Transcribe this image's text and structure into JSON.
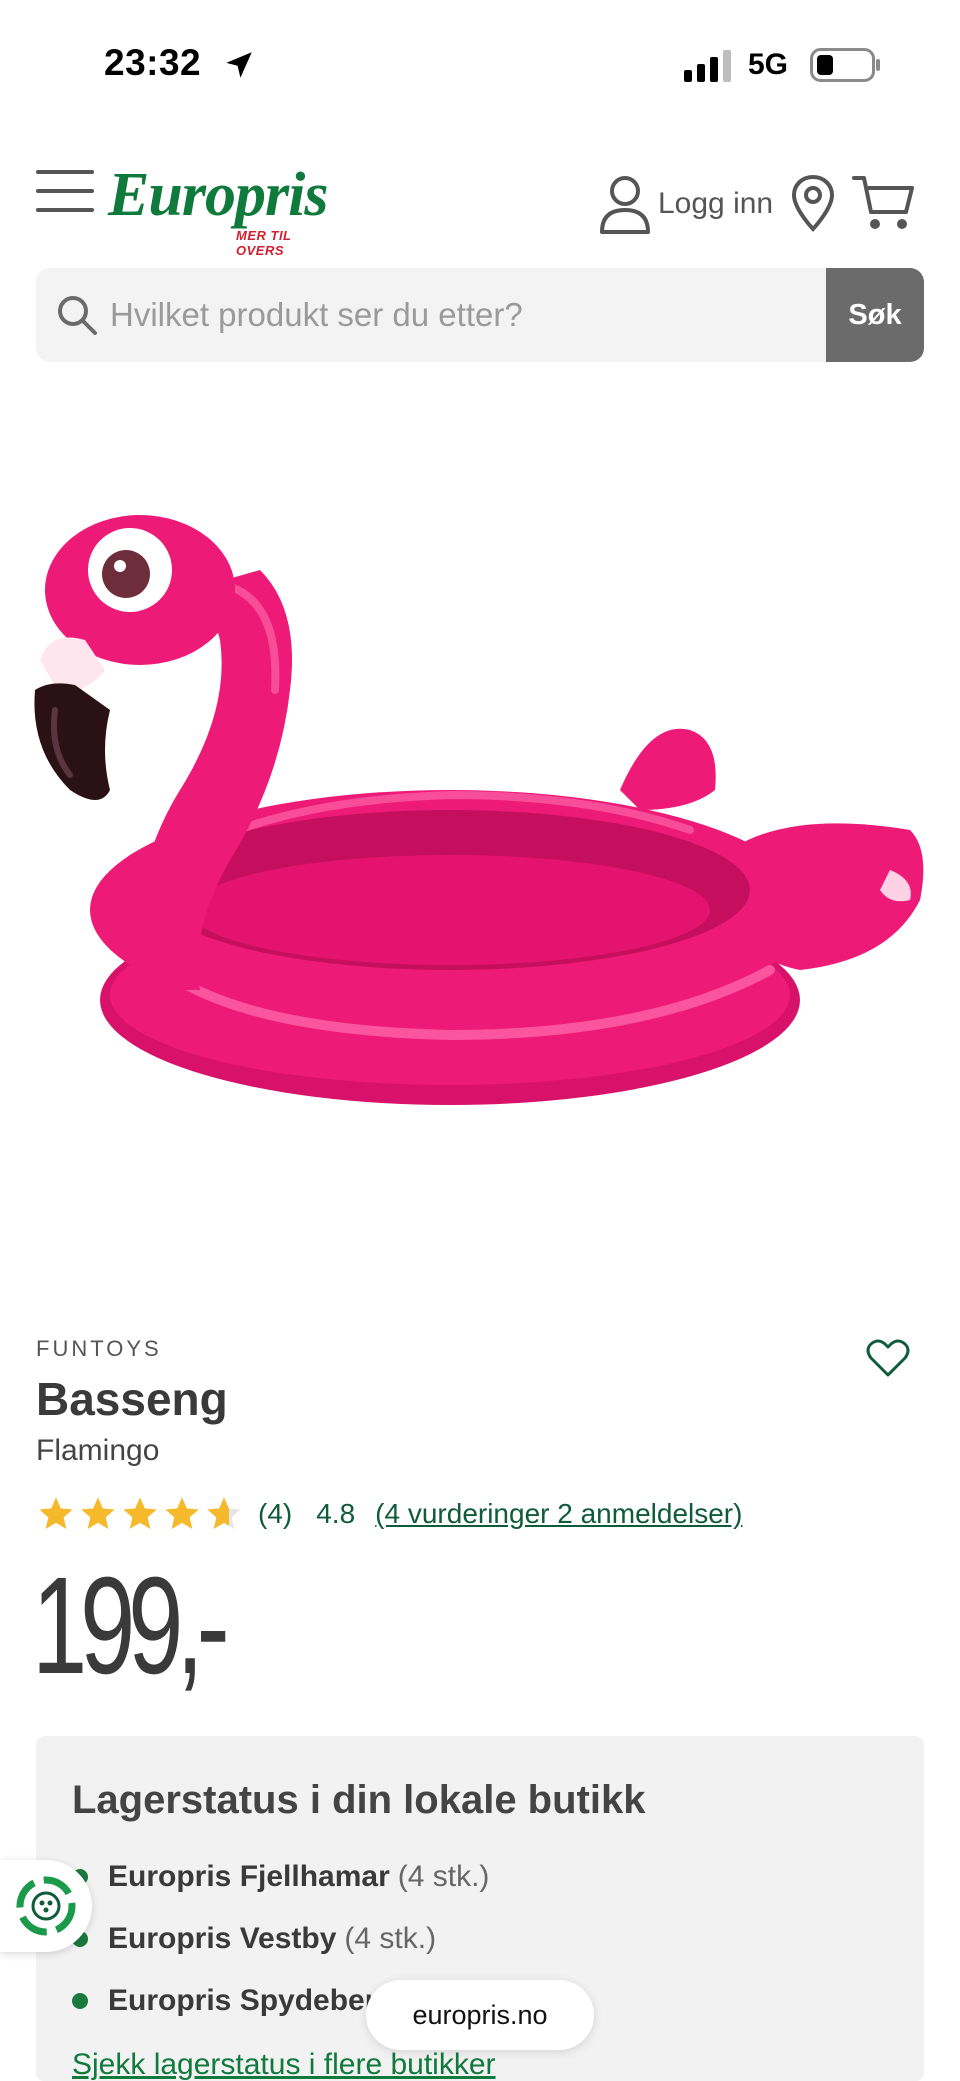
{
  "status_bar": {
    "time": "23:32",
    "network": "5G"
  },
  "header": {
    "logo_text": "Europris",
    "logo_tagline": "MER TIL OVERS",
    "login_label": "Logg inn"
  },
  "search": {
    "placeholder": "Hvilket produkt ser du etter?",
    "button_label": "Søk"
  },
  "product": {
    "brand": "FUNTOYS",
    "title": "Basseng",
    "subtitle": "Flamingo",
    "rating_count": "(4)",
    "rating_value": "4.8",
    "rating_link": "(4 vurderinger 2 anmeldelser)",
    "rating_stars": 4.8,
    "price": "199,-",
    "image_colors": {
      "body": "#ee1a78",
      "highlight": "#ff5fa6",
      "shade": "#c50f5e",
      "beak": "#2a1116"
    }
  },
  "stock": {
    "title": "Lagerstatus i din lokale butikk",
    "stores": [
      {
        "name": "Europris Fjellhamar",
        "qty": "(4 stk.)"
      },
      {
        "name": "Europris Vestby",
        "qty": "(4 stk.)"
      },
      {
        "name": "Europris Spydeberg",
        "qty": ""
      }
    ],
    "more_link": "Sjekk lagerstatus i flere butikker"
  },
  "browser": {
    "url": "europris.no"
  },
  "colors": {
    "brand_green": "#0f7a3c",
    "brand_red": "#d1202f",
    "star_yellow": "#f6b92b",
    "link_green": "#0f5b3a"
  }
}
